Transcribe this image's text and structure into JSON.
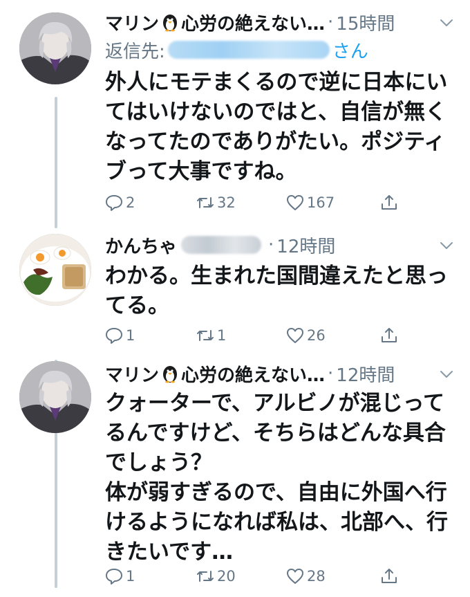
{
  "tweets": [
    {
      "name": "マリン",
      "name_suffix": "心労の絶えない…",
      "separator": "·",
      "time": "15時間",
      "reply_prefix": "返信先:",
      "reply_suffix": "さん",
      "text": "外人にモテまくるので逆に日本にいてはいけないのではと、自信が無くなってたのでありがたい。ポジティブって大事ですね。",
      "replies": "2",
      "retweets": "32",
      "likes": "167"
    },
    {
      "name": "かんちゃ",
      "separator": "·",
      "time": "12時間",
      "text": "わかる。生まれた国間違えたと思ってる。",
      "replies": "1",
      "retweets": "1",
      "likes": "26"
    },
    {
      "name": "マリン",
      "name_suffix": "心労の絶えない…",
      "separator": "·",
      "time": "12時間",
      "text": "クォーターで、アルビノが混じってるんですけど、そちらはどんな具合でしょう？\n体が弱すぎるので、自由に外国へ行けるようになれば私は、北部へ、行きたいです…",
      "replies": "1",
      "retweets": "20",
      "likes": "28"
    }
  ],
  "icons": {
    "reply": "reply-icon",
    "retweet": "retweet-icon",
    "like": "heart-icon",
    "share": "share-icon",
    "more": "chevron-down-icon",
    "emoji": "penguin-emoji"
  },
  "colors": {
    "text": "#14171a",
    "secondary": "#657786",
    "link": "#1da1f2",
    "thread_line": "#c4cfd6"
  }
}
